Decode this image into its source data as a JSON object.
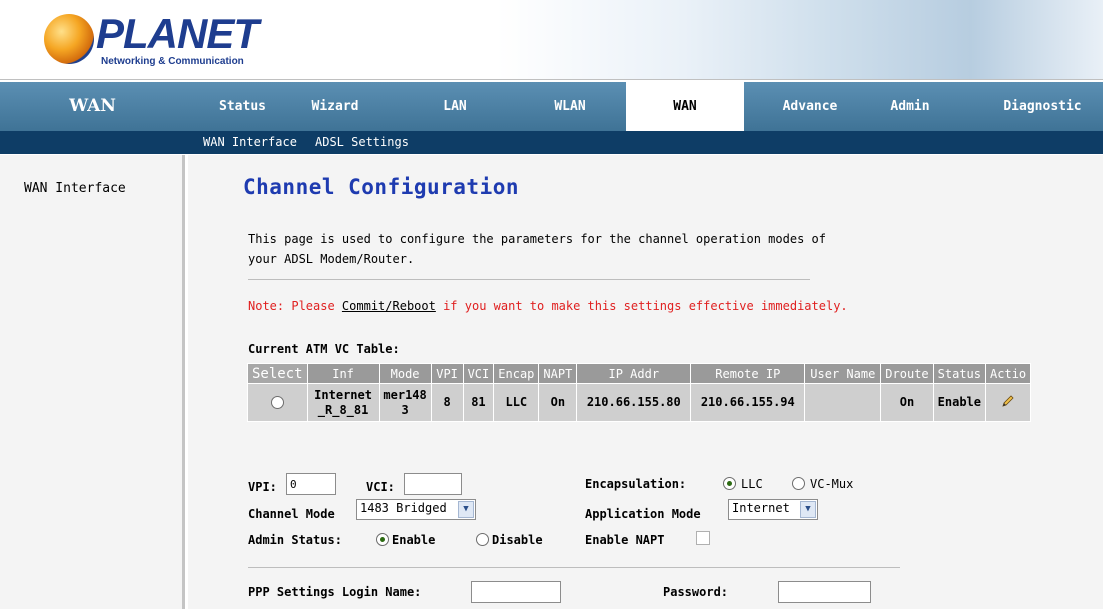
{
  "brand": {
    "logo_word": "PLANET",
    "logo_tagline": "Networking & Communication"
  },
  "nav": {
    "section_title": "WAN",
    "items": [
      "Status",
      "Wizard",
      "LAN",
      "WLAN",
      "WAN",
      "Advance",
      "Admin",
      "Diagnostic"
    ],
    "active": "WAN"
  },
  "subnav": {
    "items": [
      "WAN Interface",
      "ADSL Settings"
    ]
  },
  "sidebar": {
    "items": [
      "WAN Interface"
    ]
  },
  "page": {
    "title": "Channel Configuration",
    "description": "This page is used to configure the parameters for the channel operation modes of your ADSL Modem/Router.",
    "note_prefix": "Note: Please ",
    "note_link": "Commit/Reboot",
    "note_suffix": " if you want to make this settings effective immediately."
  },
  "vc_table": {
    "caption": "Current ATM VC Table:",
    "columns": [
      "Select",
      "Inf",
      "Mode",
      "VPI",
      "VCI",
      "Encap",
      "NAPT",
      "IP Addr",
      "Remote IP",
      "User Name",
      "Droute",
      "Status",
      "Actio"
    ],
    "rows": [
      {
        "inf": "Internet_R_8_81",
        "mode": "mer1483",
        "vpi": "8",
        "vci": "81",
        "encap": "LLC",
        "napt": "On",
        "ip_addr": "210.66.155.80",
        "remote_ip": "210.66.155.94",
        "user_name": "",
        "droute": "On",
        "status": "Enable"
      }
    ]
  },
  "form": {
    "vpi_label": "VPI:",
    "vpi_value": "0",
    "vci_label": "VCI:",
    "vci_value": "",
    "encap_label": "Encapsulation:",
    "encap_opt1": "LLC",
    "encap_opt2": "VC-Mux",
    "encap_selected": "LLC",
    "channel_mode_label": "Channel Mode",
    "channel_mode_value": "1483 Bridged",
    "app_mode_label": "Application Mode",
    "app_mode_value": "Internet",
    "admin_status_label": "Admin Status:",
    "admin_opt1": "Enable",
    "admin_opt2": "Disable",
    "admin_selected": "Enable",
    "enable_napt_label": "Enable NAPT",
    "enable_napt_checked": false,
    "ppp_login_label": "PPP Settings Login Name:",
    "ppp_login_value": "",
    "password_label": "Password:",
    "password_value": ""
  },
  "colors": {
    "nav_bg": "#4a7fa3",
    "subnav_bg": "#0e3d66",
    "title": "#1e3bb0",
    "note": "#e02020"
  }
}
